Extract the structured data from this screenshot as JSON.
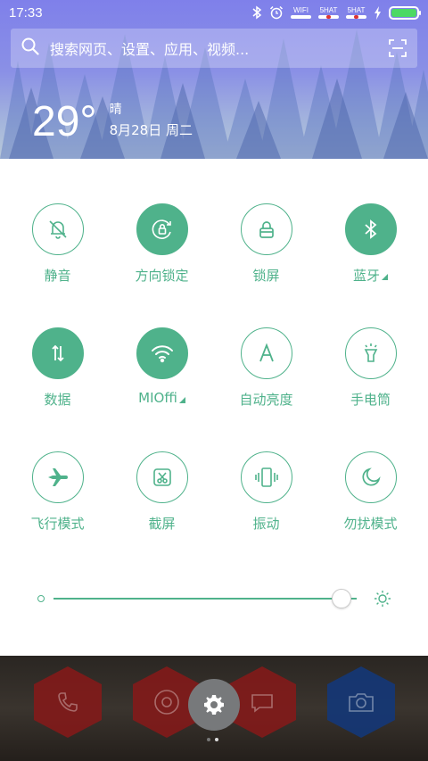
{
  "status_bar": {
    "time": "17:33",
    "wifi_label": "WIFI",
    "sim1_label": "5HAT",
    "sim2_label": "5HAT",
    "icons": [
      "bluetooth-icon",
      "alarm-icon",
      "charging-icon",
      "battery-icon"
    ]
  },
  "search": {
    "placeholder": "搜索网页、设置、应用、视频..."
  },
  "weather": {
    "temperature": "29°",
    "condition": "晴",
    "date": "8月28日 周二"
  },
  "toggles": [
    {
      "label": "静音",
      "icon": "mute-bell-icon",
      "active": false
    },
    {
      "label": "方向锁定",
      "icon": "rotation-lock-icon",
      "active": true
    },
    {
      "label": "锁屏",
      "icon": "lock-icon",
      "active": false
    },
    {
      "label": "蓝牙",
      "icon": "bluetooth-icon",
      "active": true,
      "expandable": true
    },
    {
      "label": "数据",
      "icon": "mobile-data-icon",
      "active": true
    },
    {
      "label": "MIOffi",
      "icon": "wifi-icon",
      "active": true,
      "expandable": true
    },
    {
      "label": "自动亮度",
      "icon": "auto-brightness-icon",
      "active": false
    },
    {
      "label": "手电筒",
      "icon": "flashlight-icon",
      "active": false
    },
    {
      "label": "飞行模式",
      "icon": "airplane-icon",
      "active": false
    },
    {
      "label": "截屏",
      "icon": "screenshot-icon",
      "active": false
    },
    {
      "label": "振动",
      "icon": "vibrate-icon",
      "active": false
    },
    {
      "label": "勿扰模式",
      "icon": "moon-icon",
      "active": false
    }
  ],
  "brightness": {
    "level": 0.95
  },
  "dock": {
    "apps": [
      "phone-icon",
      "browser-icon",
      "settings-icon",
      "messages-icon",
      "camera-icon"
    ],
    "pages": 2,
    "current_page": 2
  },
  "colors": {
    "accent": "#4fb28b",
    "battery": "#4cd964"
  }
}
